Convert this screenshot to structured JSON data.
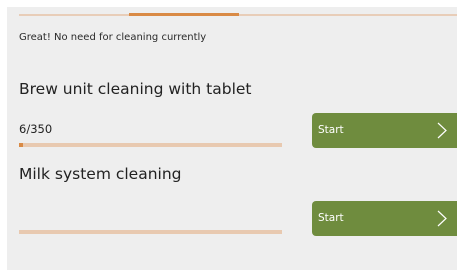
{
  "status": {
    "message": "Great! No need for cleaning currently"
  },
  "page_indicator": {
    "active_index": 1,
    "count": 4
  },
  "brew_unit": {
    "title": "Brew unit cleaning with tablet",
    "counter": "6/350",
    "progress": 0.017,
    "button_label": "Start"
  },
  "milk_system": {
    "title": "Milk system cleaning",
    "counter": "",
    "progress": 0,
    "button_label": "Start"
  },
  "colors": {
    "accent_orange": "#d98a45",
    "track_light": "#e8c9b0",
    "button_green": "#6f8c3e",
    "background": "#eeeeee"
  }
}
